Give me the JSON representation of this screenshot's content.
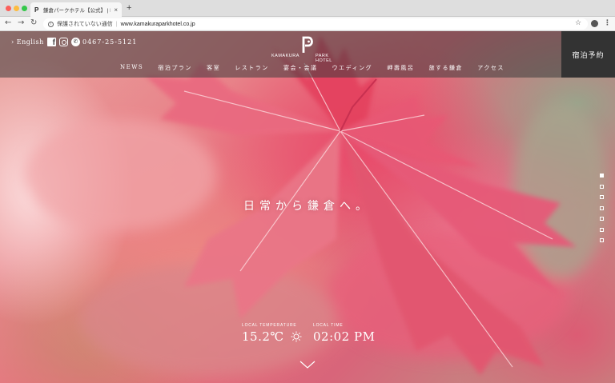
{
  "browser": {
    "tab_title": "鎌倉パークホテル【公式】 | KA",
    "tab_favicon": "P",
    "tab_close": "×",
    "new_tab": "+",
    "security_text": "保護されていない通信",
    "url": "www.kamakuraparkhotel.co.jp"
  },
  "header": {
    "lang_link": "› English",
    "phone": "0467-25-5121",
    "logo_left": "KAMAKURA",
    "logo_right": "PARK HOTEL",
    "book_button": "宿泊予約",
    "nav": [
      "NEWS",
      "宿泊プラン",
      "客室",
      "レストラン",
      "宴会・会議",
      "ウエディング",
      "岬壽風呂",
      "旅する鎌倉",
      "アクセス"
    ]
  },
  "hero": {
    "tagline": "日常から鎌倉へ。",
    "slide_count": 7,
    "active_slide": 1
  },
  "weather": {
    "temp_label": "LOCAL TEMPERATURE",
    "temp_value": "15.2℃",
    "time_label": "LOCAL TIME",
    "time_value": "02:02 PM"
  },
  "icons": {
    "facebook": "facebook-icon",
    "instagram": "instagram-icon",
    "phone": "phone-icon",
    "weather": "sun-icon",
    "scroll": "chevron-down-icon"
  },
  "colors": {
    "header_overlay": "#3c3c3c",
    "book_button_bg": "#333333",
    "leaf_red": "#e04868"
  }
}
